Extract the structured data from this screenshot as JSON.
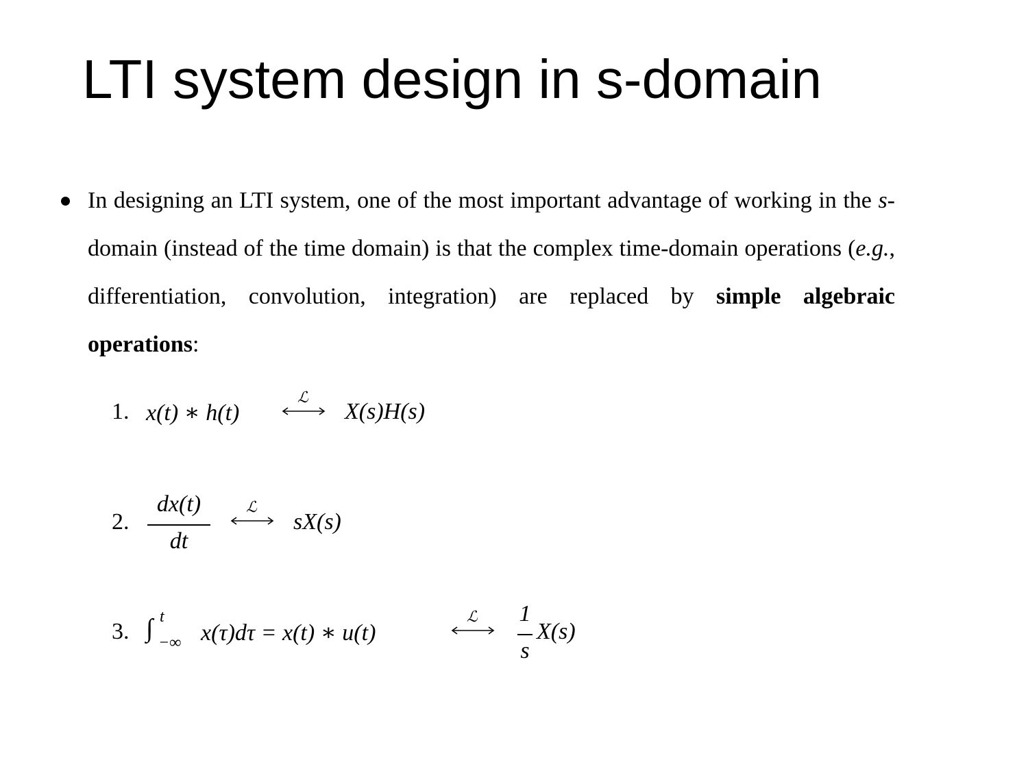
{
  "title": "LTI system design in s-domain",
  "paragraph": {
    "part1": "In designing an LTI system, one of the most important advantage of working in the ",
    "s_var": "s",
    "part2": "-domain (instead of the time domain) is that the complex time-domain operations (",
    "eg": "e.g.",
    "part3": ", differentiation, convolution, integration) are replaced by ",
    "bold": "simple algebraic operations",
    "part4": ":"
  },
  "laplace_symbol": "ℒ",
  "equations": [
    {
      "number": "1.",
      "lhs": "x(t) ∗ h(t)",
      "rhs": "X(s)H(s)"
    },
    {
      "number": "2.",
      "lhs_num": "dx(t)",
      "lhs_den": "dt",
      "rhs": "sX(s)"
    },
    {
      "number": "3.",
      "integral": "∫",
      "upper": "t",
      "lower": "−∞",
      "lhs": "x(τ)dτ = x(t) ∗ u(t)",
      "rhs_num": "1",
      "rhs_den": "s",
      "rhs": "X(s)"
    }
  ]
}
